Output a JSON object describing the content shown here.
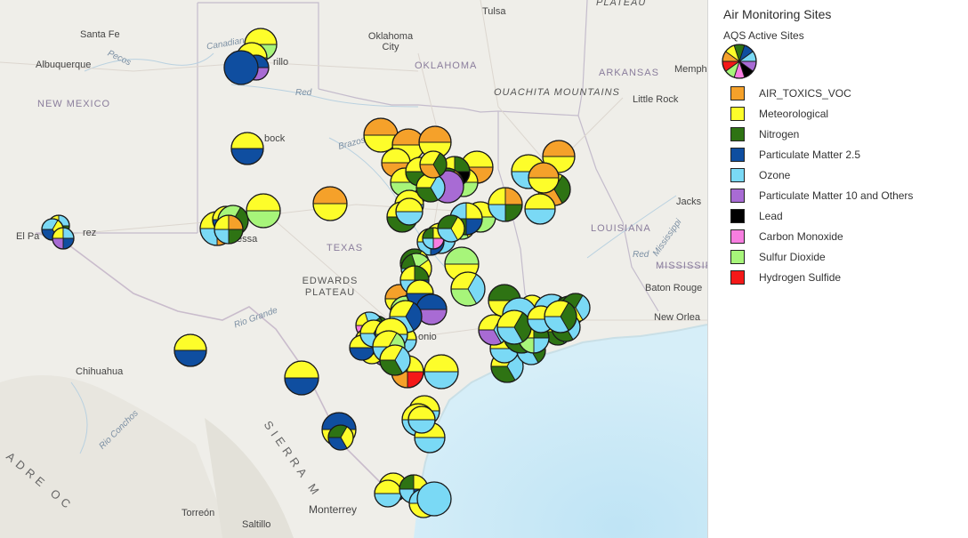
{
  "map": {
    "labels": {
      "santa_fe": "Santa Fe",
      "albuquerque": "Albuquerque",
      "pecos": "Pecos",
      "canadian": "Canadian",
      "amarillo": "rillo",
      "oklahoma_city": "Oklahoma City",
      "oklahoma": "OKLAHOMA",
      "tulsa": "Tulsa",
      "plateau": "PLATEAU",
      "arkansas": "ARKANSAS",
      "ouachita": "OUACHITA MOUNTAINS",
      "little_rock": "Little Rock",
      "memphis": "Memph",
      "new_mexico": "NEW MEXICO",
      "red": "Red",
      "lubbock": "bock",
      "brazos": "Brazos",
      "texas": "TEXAS",
      "el_paso": "El Pa",
      "juarez": "rez",
      "odessa": "essa",
      "edwards_plateau": "EDWARDS PLATEAU",
      "louisiana": "LOUISIANA",
      "jackson": "Jacks",
      "mississippi_river": "Mississippi",
      "red_la": "Red",
      "mississippi": "MISSISSIPPI",
      "baton_rouge": "Baton Rouge",
      "new_orleans": "New Orlea",
      "rio_grande": "Rio Grande",
      "chihuahua": "Chihuahua",
      "rio_conchos": "Rio Conchos",
      "sierra_madre": "SIERRA M",
      "madre_occidental": "ADRE OC",
      "san_antonio": "onio",
      "monterrey": "Monterrey",
      "torreon": "Torreón",
      "saltillo": "Saltillo"
    }
  },
  "legend": {
    "title": "Air Monitoring Sites",
    "subtitle": "AQS Active Sites",
    "items": [
      {
        "label": "AIR_TOXICS_VOC",
        "color": "#f5a12a"
      },
      {
        "label": "Meteorological",
        "color": "#fdfd2a"
      },
      {
        "label": "Nitrogen",
        "color": "#2e7313"
      },
      {
        "label": "Particulate Matter 2.5",
        "color": "#0f4ea0"
      },
      {
        "label": "Ozone",
        "color": "#7ad9f5"
      },
      {
        "label": "Particulate Matter 10 and Others",
        "color": "#a86bd4"
      },
      {
        "label": "Lead",
        "color": "#000000"
      },
      {
        "label": "Carbon Monoxide",
        "color": "#f77ee0"
      },
      {
        "label": "Sulfur Dioxide",
        "color": "#a7f57a"
      },
      {
        "label": "Hydrogen Sulfide",
        "color": "#f41818"
      }
    ]
  },
  "sites": [
    {
      "s": [
        1,
        8
      ]
    },
    {
      "s": [
        1,
        4
      ]
    },
    {
      "s": [
        3,
        5
      ]
    },
    {
      "s": [
        3
      ]
    },
    {
      "s": [
        1,
        3
      ]
    },
    {
      "s": [
        1,
        3
      ]
    },
    {
      "s": [
        0,
        1
      ]
    },
    {
      "s": [
        0,
        1
      ]
    },
    {
      "s": [
        0,
        1
      ]
    },
    {
      "s": [
        0,
        1
      ]
    },
    {
      "s": [
        1,
        2,
        0,
        4
      ]
    },
    {
      "s": [
        1,
        3
      ]
    },
    {
      "s": [
        8,
        2,
        1
      ]
    },
    {
      "s": [
        1,
        8
      ]
    },
    {
      "s": [
        1,
        0,
        2,
        4
      ]
    },
    {
      "s": [
        1,
        3
      ]
    },
    {
      "s": [
        1,
        8
      ]
    },
    {
      "s": [
        1,
        4,
        2,
        3
      ]
    },
    {
      "s": [
        4,
        1,
        3
      ]
    },
    {
      "s": [
        1,
        4,
        3,
        5
      ]
    },
    {
      "s": [
        1,
        0,
        9,
        2
      ]
    },
    {
      "s": [
        1,
        0
      ]
    },
    {
      "s": [
        1,
        0
      ]
    },
    {
      "s": [
        1,
        8
      ]
    },
    {
      "s": [
        1,
        4
      ]
    },
    {
      "s": [
        0,
        1
      ]
    },
    {
      "s": [
        1,
        2,
        0
      ]
    },
    {
      "s": [
        0,
        1
      ]
    },
    {
      "s": [
        1,
        0,
        2,
        4
      ]
    },
    {
      "s": [
        1,
        4
      ]
    },
    {
      "s": [
        1,
        2,
        6,
        0
      ]
    },
    {
      "s": [
        1,
        2,
        0,
        4,
        3,
        5
      ]
    },
    {
      "s": [
        4,
        1,
        2
      ]
    },
    {
      "s": [
        1,
        8
      ]
    },
    {
      "s": [
        1,
        4
      ]
    },
    {
      "s": [
        5
      ]
    },
    {
      "s": [
        1,
        2
      ]
    },
    {
      "s": [
        1,
        4,
        2
      ]
    },
    {
      "s": [
        1,
        2,
        0
      ]
    },
    {
      "s": [
        2,
        1,
        8
      ]
    },
    {
      "s": [
        8,
        1
      ]
    },
    {
      "s": [
        1,
        4
      ]
    },
    {
      "s": [
        1,
        2,
        3,
        4
      ]
    },
    {
      "s": [
        4,
        1,
        3,
        2
      ]
    },
    {
      "s": [
        2,
        1,
        8
      ]
    },
    {
      "s": [
        2,
        8,
        1,
        3,
        4
      ]
    },
    {
      "s": [
        0,
        1
      ]
    },
    {
      "s": [
        1,
        8
      ]
    },
    {
      "s": [
        8,
        1
      ]
    },
    {
      "s": [
        1,
        2,
        3,
        4
      ]
    },
    {
      "s": [
        2,
        1,
        7,
        4
      ]
    },
    {
      "s": [
        2,
        1,
        4
      ]
    },
    {
      "s": [
        1,
        4,
        8
      ]
    },
    {
      "s": [
        2,
        1
      ]
    },
    {
      "s": [
        1,
        8
      ]
    },
    {
      "s": [
        3,
        1
      ]
    },
    {
      "s": [
        2,
        1,
        3
      ]
    },
    {
      "s": [
        1,
        4
      ]
    },
    {
      "s": [
        1,
        4
      ]
    },
    {
      "s": [
        1,
        4
      ]
    },
    {
      "s": [
        1,
        4
      ]
    },
    {
      "s": [
        1,
        4,
        2
      ]
    },
    {
      "s": [
        1,
        4
      ]
    },
    {
      "s": [
        1,
        2,
        4
      ]
    },
    {
      "s": [
        1,
        3,
        2
      ]
    },
    {
      "s": [
        1,
        4,
        5
      ]
    },
    {
      "s": [
        5
      ]
    },
    {
      "s": [
        2,
        1,
        9,
        0
      ]
    },
    {
      "s": [
        1,
        4
      ]
    },
    {
      "s": [
        1,
        3
      ]
    },
    {
      "s": [
        1,
        4
      ]
    },
    {
      "s": [
        2,
        1,
        3,
        4
      ]
    },
    {
      "s": [
        4,
        2,
        1
      ]
    },
    {
      "s": [
        4
      ]
    },
    {
      "s": [
        4,
        2,
        1
      ]
    },
    {
      "s": [
        4
      ]
    },
    {
      "s": [
        1,
        4,
        2
      ]
    },
    {
      "s": [
        1,
        2,
        4,
        8
      ]
    },
    {
      "s": [
        1,
        2,
        4
      ]
    },
    {
      "s": [
        1,
        4
      ]
    },
    {
      "s": [
        2,
        1,
        4,
        3
      ]
    },
    {
      "s": [
        2,
        4,
        1
      ]
    },
    {
      "s": [
        1,
        4,
        2
      ]
    },
    {
      "s": [
        1,
        2,
        4
      ]
    },
    {
      "s": [
        1,
        2
      ]
    },
    {
      "s": [
        1,
        4
      ]
    },
    {
      "s": [
        1,
        4,
        2,
        9,
        7
      ]
    },
    {
      "s": [
        1,
        8,
        4,
        2
      ]
    },
    {
      "s": [
        4,
        1
      ]
    },
    {
      "s": [
        1,
        2,
        3,
        4
      ]
    },
    {
      "s": [
        1,
        3
      ]
    },
    {
      "s": [
        3,
        5
      ]
    },
    {
      "s": [
        1,
        4
      ]
    },
    {
      "s": [
        1,
        3,
        4
      ]
    },
    {
      "s": [
        1,
        4,
        3
      ]
    },
    {
      "s": [
        1,
        3
      ]
    },
    {
      "s": [
        1,
        3,
        4
      ]
    },
    {
      "s": [
        1,
        4
      ]
    },
    {
      "s": [
        1,
        8,
        4
      ]
    },
    {
      "s": [
        1,
        4,
        2
      ]
    }
  ]
}
